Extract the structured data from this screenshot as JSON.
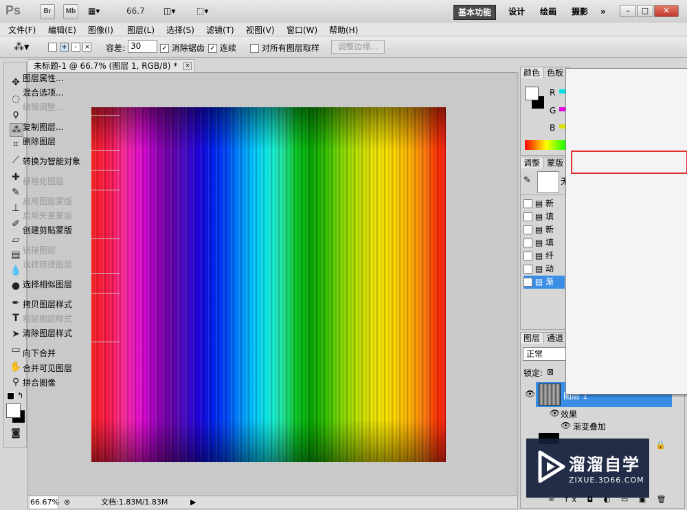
{
  "titlebar": {
    "app_logo": "Ps",
    "bridge_btn": "Br",
    "minibridge_btn": "Mb",
    "zoom": "66.7",
    "workspaces": [
      "基本功能",
      "设计",
      "绘画",
      "摄影"
    ],
    "more": "»"
  },
  "menu": [
    "文件(F)",
    "编辑(E)",
    "图像(I)",
    "图层(L)",
    "选择(S)",
    "滤镜(T)",
    "视图(V)",
    "窗口(W)",
    "帮助(H)"
  ],
  "options": {
    "tolerance_label": "容差:",
    "tolerance_value": "30",
    "antialias_label": "消除锯齿",
    "contiguous_label": "连续",
    "sample_all_label": "对所有图层取样",
    "refine_edge_label": "调整边缘..."
  },
  "document": {
    "tab_title": "未标题-1 @ 66.7% (图层 1, RGB/8) *",
    "close": "×",
    "zoom_status": "66.67%",
    "doc_info": "文档:1.83M/1.83M"
  },
  "color_panel": {
    "tabs": [
      "颜色",
      "色板"
    ],
    "channels": [
      "R",
      "G",
      "B"
    ]
  },
  "adjust_panel": {
    "tabs": [
      "调整",
      "蒙版"
    ],
    "layer_stubs": [
      "新",
      "填",
      "新",
      "填",
      "纤",
      "动",
      "渐"
    ],
    "preview_stub": "无"
  },
  "layers_panel": {
    "tabs": [
      "图层",
      "通道"
    ],
    "blend_mode": "正常",
    "lock_label": "锁定:",
    "layer_name": "图层 1",
    "effects_label": "效果",
    "effect_name": "渐变叠加"
  },
  "context_menu": {
    "items": [
      {
        "label": "图层属性...",
        "disabled": false
      },
      {
        "label": "混合选项...",
        "disabled": false
      },
      {
        "label": "编辑调整...",
        "disabled": true
      },
      {
        "label": "复制图层...",
        "disabled": false
      },
      {
        "label": "删除图层",
        "disabled": false
      },
      {
        "label": "转换为智能对象",
        "disabled": false
      },
      {
        "label": "栅格化图层",
        "disabled": true
      },
      {
        "label": "启用图层蒙版",
        "disabled": true
      },
      {
        "label": "启用矢量蒙版",
        "disabled": true
      },
      {
        "label": "创建剪贴蒙版",
        "disabled": false
      },
      {
        "label": "链接图层",
        "disabled": true
      },
      {
        "label": "选择链接图层",
        "disabled": true
      },
      {
        "label": "选择相似图层",
        "disabled": false
      },
      {
        "label": "拷贝图层样式",
        "disabled": false
      },
      {
        "label": "粘贴图层样式",
        "disabled": true
      },
      {
        "label": "清除图层样式",
        "disabled": false
      },
      {
        "label": "向下合并",
        "disabled": false
      },
      {
        "label": "合并可见图层",
        "disabled": false
      },
      {
        "label": "拼合图像",
        "disabled": false
      }
    ]
  },
  "watermark": {
    "title": "溜溜自学",
    "url": "ZIXUE.3D66.COM"
  },
  "colors": {
    "highlight": "#e03030",
    "selected_layer": "#3a8ee6",
    "accent_dark": "#4a4a4a"
  }
}
